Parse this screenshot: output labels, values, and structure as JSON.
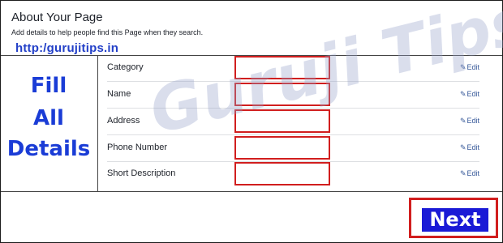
{
  "header": {
    "title": "About Your Page",
    "subtitle": "Add details to help people find this Page when they search.",
    "site_url": "http:/gurujitips.in"
  },
  "overlay": {
    "line1": "Fill",
    "line2": "All",
    "line3": "Details"
  },
  "watermark": "Guruji Tips",
  "fields": [
    {
      "label": "Category",
      "value": "",
      "edit_label": "Edit"
    },
    {
      "label": "Name",
      "value": "",
      "edit_label": "Edit"
    },
    {
      "label": "Address",
      "value": "",
      "edit_label": "Edit"
    },
    {
      "label": "Phone Number",
      "value": "",
      "edit_label": "Edit"
    },
    {
      "label": "Short Description",
      "value": "",
      "edit_label": "Edit"
    }
  ],
  "footer": {
    "next_label": "Next"
  },
  "colors": {
    "highlight_red": "#d11e1e",
    "overlay_blue": "#1a3cd6",
    "next_bg": "#1a1ad6",
    "link_blue": "#365899"
  },
  "icons": {
    "edit": "pencil-icon"
  }
}
